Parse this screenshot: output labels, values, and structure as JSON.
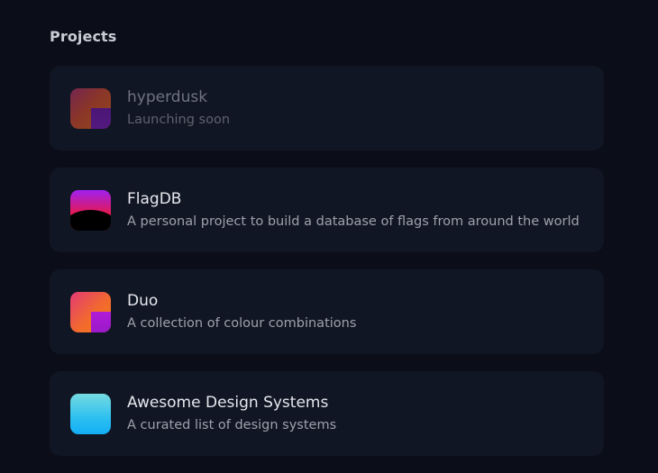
{
  "section": {
    "title": "Projects"
  },
  "projects": [
    {
      "title": "hyperdusk",
      "description": "Launching soon",
      "icon": "hyperdusk-logo-icon"
    },
    {
      "title": "FlagDB",
      "description": "A personal project to build a database of flags from around the world",
      "icon": "flagdb-logo-icon"
    },
    {
      "title": "Duo",
      "description": "A collection of colour combinations",
      "icon": "duo-logo-icon"
    },
    {
      "title": "Awesome Design Systems",
      "description": "A curated list of design systems",
      "icon": "awesome-design-systems-logo-icon"
    }
  ],
  "colors": {
    "background": "#0b0e19",
    "card": "#111624",
    "title": "#e6e8ee",
    "description": "#9da1ab"
  }
}
